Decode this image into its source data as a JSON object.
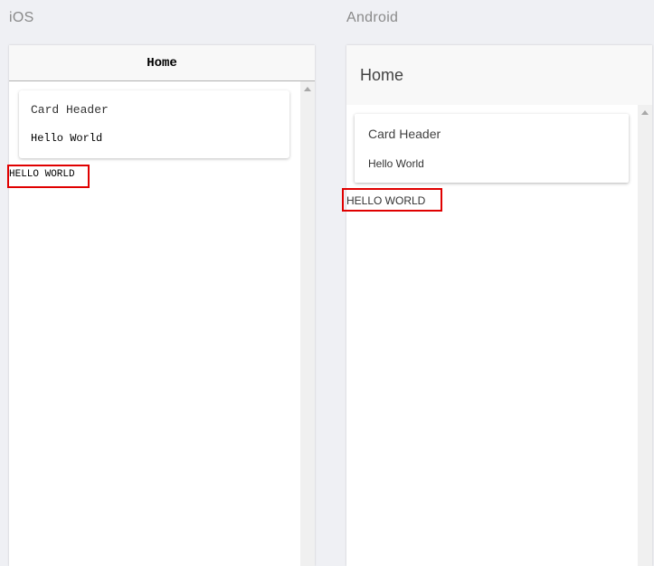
{
  "labels": {
    "ios": "iOS",
    "android": "Android"
  },
  "ios": {
    "title": "Home",
    "card": {
      "header": "Card Header",
      "body": "Hello World"
    },
    "plain_text": "HELLO WORLD"
  },
  "android": {
    "title": "Home",
    "card": {
      "header": "Card Header",
      "body": "Hello World"
    },
    "plain_text": "HELLO WORLD"
  },
  "colors": {
    "background": "#eff0f4",
    "highlight": "#e00000",
    "header_bg": "#f8f8f8"
  }
}
